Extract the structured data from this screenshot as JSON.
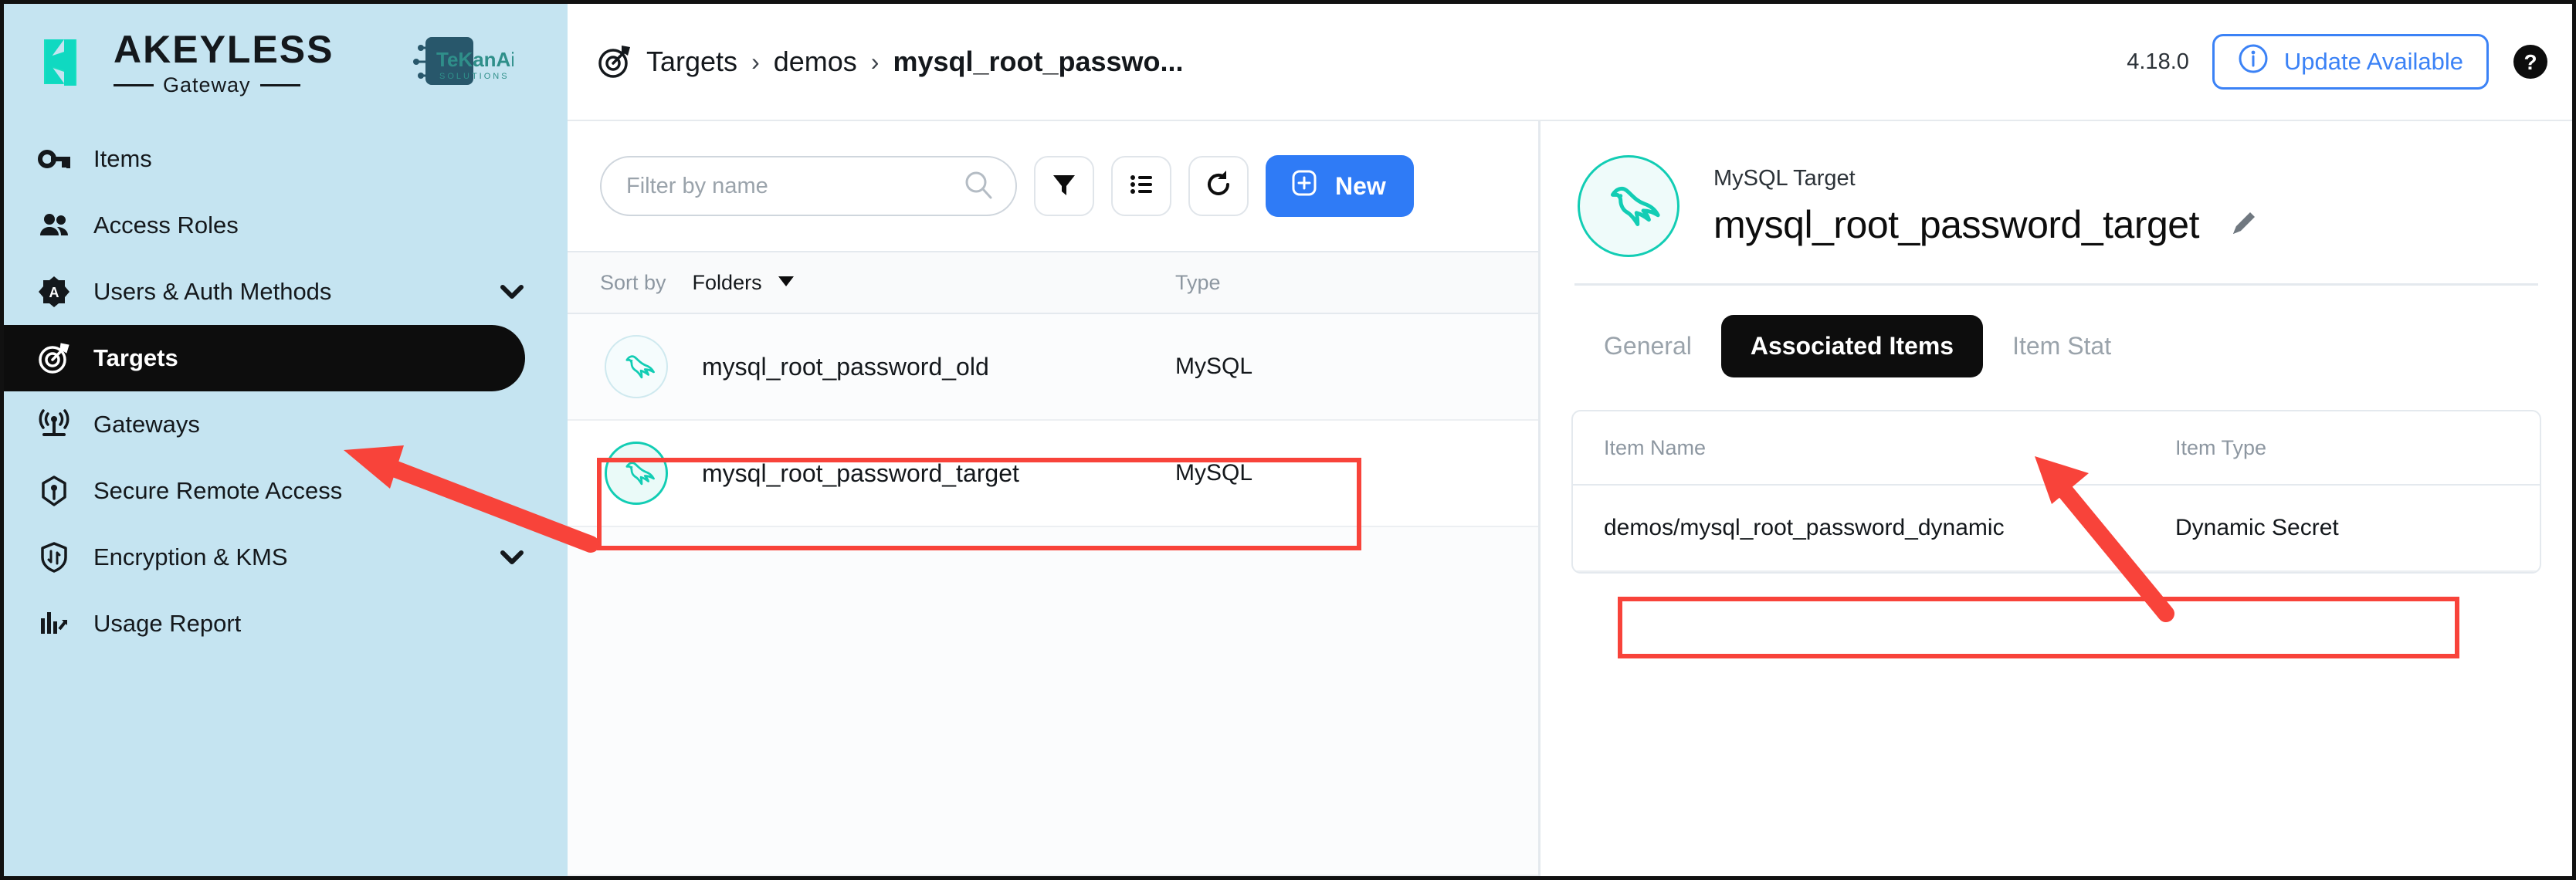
{
  "brand": {
    "name": "AKEYLESS",
    "subtitle": "Gateway",
    "partner_logo": "tekanaid-solutions-logo"
  },
  "sidebar": {
    "items": [
      {
        "label": "Items",
        "icon": "key-icon",
        "active": false,
        "chevron": false
      },
      {
        "label": "Access Roles",
        "icon": "people-icon",
        "active": false,
        "chevron": false
      },
      {
        "label": "Users & Auth Methods",
        "icon": "auth-badge-icon",
        "active": false,
        "chevron": true
      },
      {
        "label": "Targets",
        "icon": "target-icon",
        "active": true,
        "chevron": false
      },
      {
        "label": "Gateways",
        "icon": "antenna-icon",
        "active": false,
        "chevron": false
      },
      {
        "label": "Secure Remote Access",
        "icon": "hexagon-pin-icon",
        "active": false,
        "chevron": false
      },
      {
        "label": "Encryption & KMS",
        "icon": "shield-key-icon",
        "active": false,
        "chevron": true
      },
      {
        "label": "Usage Report",
        "icon": "bar-chart-icon",
        "active": false,
        "chevron": false
      }
    ]
  },
  "topbar": {
    "breadcrumb_icon": "target-icon",
    "crumbs": [
      "Targets",
      "demos",
      "mysql_root_passwo..."
    ],
    "separator": "›",
    "version": "4.18.0",
    "update_label": "Update Available",
    "update_icon": "info-circle-icon",
    "help_icon": "help-circle-icon",
    "accent_blue": "#3b82f6"
  },
  "list_panel": {
    "filter_placeholder": "Filter by name",
    "filter_value": "",
    "search_icon": "search-icon",
    "buttons": [
      {
        "name": "filter-button",
        "icon": "funnel-icon"
      },
      {
        "name": "list-view-button",
        "icon": "list-icon"
      },
      {
        "name": "refresh-button",
        "icon": "refresh-icon"
      }
    ],
    "new_label": "New",
    "new_icon": "plus-square-icon",
    "sort_label": "Sort by",
    "sort_value": "Folders",
    "type_header": "Type",
    "rows": [
      {
        "name": "mysql_root_password_old",
        "type": "MySQL",
        "icon": "mysql-dolphin-icon",
        "selected": false
      },
      {
        "name": "mysql_root_password_target",
        "type": "MySQL",
        "icon": "mysql-dolphin-icon",
        "selected": true
      }
    ]
  },
  "detail": {
    "avatar_icon": "mysql-dolphin-icon",
    "kicker": "MySQL Target",
    "title": "mysql_root_password_target",
    "edit_icon": "pencil-icon",
    "tabs": [
      {
        "label": "General",
        "active": false
      },
      {
        "label": "Associated Items",
        "active": true
      },
      {
        "label": "Item Stat",
        "active": false
      }
    ],
    "associated": {
      "columns": [
        "Item Name",
        "Item Type"
      ],
      "rows": [
        {
          "item_name": "demos/mysql_root_password_dynamic",
          "item_type": "Dynamic Secret"
        }
      ]
    }
  },
  "annotations": {
    "highlight_color": "#f8433a",
    "arrows": [
      {
        "name": "arrow-to-targets-nav",
        "points_to": "Targets"
      },
      {
        "name": "arrow-to-associated-items-tab",
        "points_to": "Associated Items"
      }
    ],
    "boxes": [
      {
        "name": "highlight-box-target-row",
        "around": "mysql_root_password_target"
      },
      {
        "name": "highlight-box-associated-row",
        "around": "demos/mysql_root_password_dynamic"
      }
    ]
  }
}
